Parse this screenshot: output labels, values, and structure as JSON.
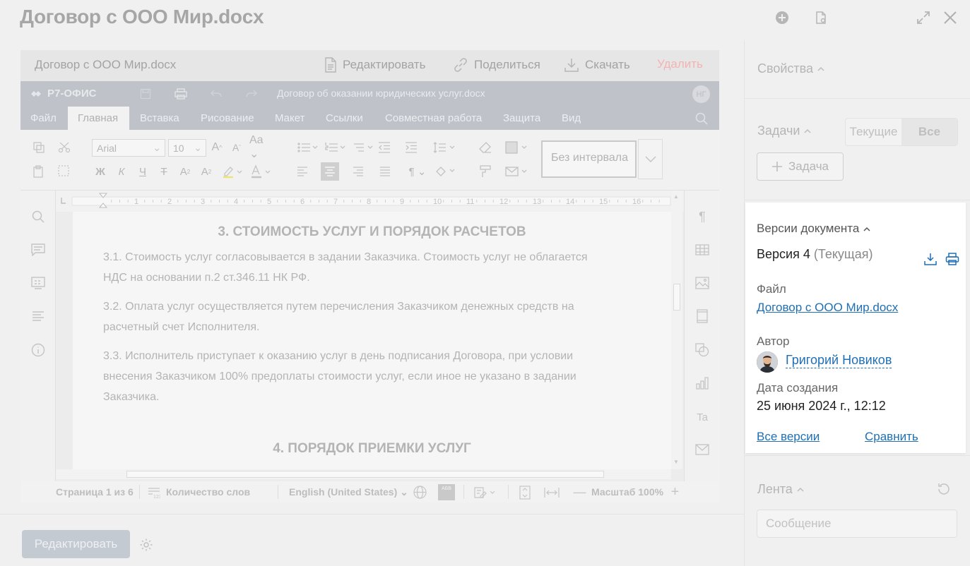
{
  "window": {
    "title": "Договор с ООО Мир.docx"
  },
  "doc_header": {
    "name": "Договор с ООО Мир.docx",
    "edit_label": "Редактировать",
    "share_label": "Поделиться",
    "download_label": "Скачать",
    "delete_label": "Удалить"
  },
  "editor_app": {
    "brand": "Р7-ОФИС",
    "doc_name": "Договор об оказании юридических услуг.docx",
    "user_initials": "НГ",
    "menu": [
      "Файл",
      "Главная",
      "Вставка",
      "Рисование",
      "Макет",
      "Ссылки",
      "Совместная работа",
      "Защита",
      "Вид"
    ],
    "active_menu": "Главная",
    "font_name": "Arial",
    "font_size": "10",
    "style_name": "Без интервала",
    "ruler_numbers": [
      "1",
      "2",
      "3",
      "4",
      "5",
      "6",
      "7",
      "8",
      "9",
      "10",
      "11",
      "12",
      "13",
      "14",
      "15",
      "16"
    ]
  },
  "document": {
    "heading3": "3. СТОИМОСТЬ УСЛУГ И ПОРЯДОК РАСЧЕТОВ",
    "p31": "3.1. Стоимость услуг согласовывается в задании Заказчика. Стоимость услуг не облагается НДС на основании п.2 ст.346.11 НК РФ.",
    "p32": "3.2. Оплата услуг осуществляется путем перечисления Заказчиком денежных средств на расчетный счет Исполнителя.",
    "p33": "3.3. Исполнитель приступает к оказанию услуг в день подписания Договора, при условии внесения Заказчиком 100% предоплаты стоимости услуг, если иное не указано в задании Заказчика.",
    "heading4": "4. ПОРЯДОК ПРИЕМКИ УСЛУГ"
  },
  "status_bar": {
    "page": "Страница 1 из 6",
    "word_count": "Количество слов",
    "language": "English (United States)",
    "zoom": "Масштаб 100%",
    "spell_icon_text": "АБВ"
  },
  "bottom": {
    "edit_button": "Редактировать"
  },
  "sidebar": {
    "properties": "Свойства",
    "tasks": "Задачи",
    "tasks_current": "Текущие",
    "tasks_all": "Все",
    "task_button": "Задача",
    "feed": "Лента",
    "message_placeholder": "Сообщение"
  },
  "versions": {
    "title": "Версии документа",
    "version": "Версия 4",
    "version_status": "(Текущая)",
    "file_label": "Файл",
    "file_name": "Договор с ООО Мир.docx",
    "author_label": "Автор",
    "author_name": "Григорий Новиков",
    "created_label": "Дата создания",
    "created_value": "25 июня 2024 г., 12:12",
    "all_versions": "Все версии",
    "compare": "Сравнить"
  },
  "colors": {
    "link": "#1f6fb4",
    "editor_chrome": "#bfc2c9",
    "card_bg": "#ffffff"
  }
}
